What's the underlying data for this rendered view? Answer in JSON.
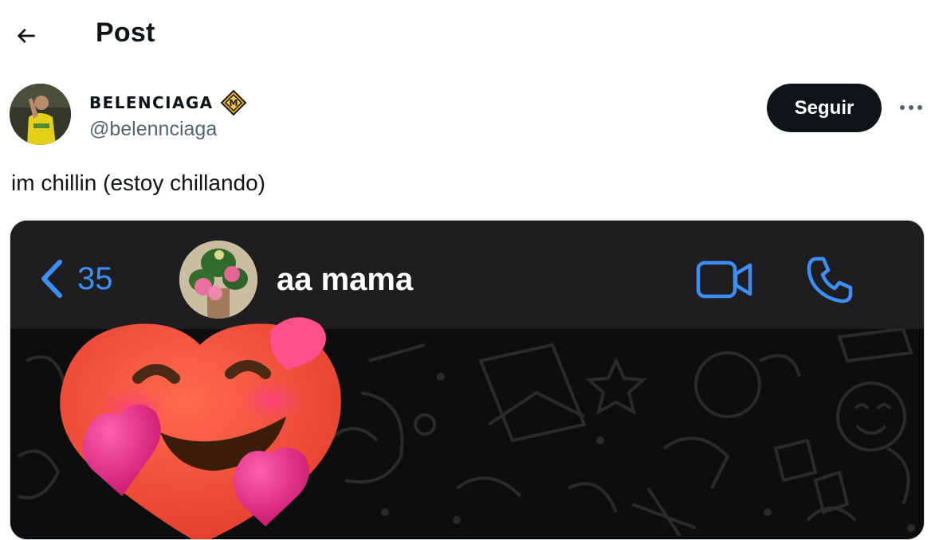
{
  "header": {
    "title": "Post",
    "back_icon": "arrow-left-icon"
  },
  "author": {
    "display_name": "BELENCIAGA",
    "handle": "@belennciaga",
    "badge_icon": "affiliate-badge-icon"
  },
  "actions": {
    "follow_label": "Seguir",
    "more_icon": "more-dots-icon"
  },
  "post": {
    "text": "im chillin (estoy chillando)"
  },
  "media": {
    "chat_header": {
      "back_count": "35",
      "contact_name": "aa mama",
      "icons": [
        "chevron-left-icon",
        "video-camera-icon",
        "phone-icon"
      ]
    },
    "sticker": "smiling-face-with-hearts"
  },
  "colors": {
    "text": "#0f1419",
    "secondary_text": "#536471",
    "follow_bg": "#0f1419",
    "chat_accent": "#3d8ff5",
    "chat_header_bg": "#1e1e20",
    "chat_bg": "#0d0d0d"
  }
}
